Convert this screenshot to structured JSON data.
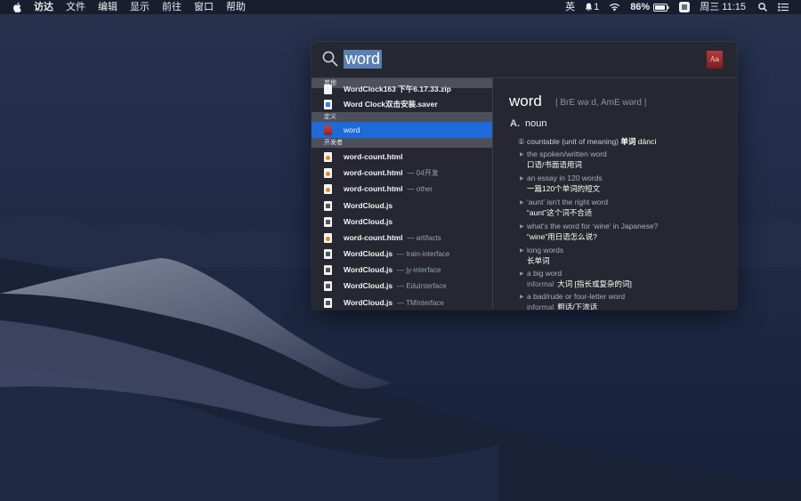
{
  "menubar": {
    "app_name": "访达",
    "items": [
      "文件",
      "编辑",
      "显示",
      "前往",
      "窗口",
      "帮助"
    ],
    "input_method": "英",
    "notification_count": "1",
    "battery": "86%",
    "clock": "周三 11:15"
  },
  "spotlight": {
    "query": "word",
    "sections": {
      "other": "其他",
      "definition": "定义",
      "developer": "开发者"
    },
    "results": [
      {
        "name": "WordClock163 下午6.17.33.zip",
        "sub": ""
      },
      {
        "name": "Word Clock双击安装.saver",
        "sub": ""
      },
      {
        "name": "word",
        "sub": ""
      },
      {
        "name": "word-count.html",
        "sub": ""
      },
      {
        "name": "word-count.html",
        "sub": "— 04开发"
      },
      {
        "name": "word-count.html",
        "sub": "— other"
      },
      {
        "name": "WordCloud.js",
        "sub": ""
      },
      {
        "name": "WordCloud.js",
        "sub": ""
      },
      {
        "name": "word-count.html",
        "sub": "— artifacts"
      },
      {
        "name": "WordCloud.js",
        "sub": "— train-interface"
      },
      {
        "name": "WordCloud.js",
        "sub": "— jy-interface"
      },
      {
        "name": "WordCloud.js",
        "sub": "— EduInterface"
      },
      {
        "name": "WordCloud.js",
        "sub": "— TMInterface"
      }
    ],
    "preview": {
      "word": "word",
      "pronunciation": "| BrE wəːd, AmE wərd |",
      "pos_letter": "A.",
      "pos": "noun",
      "sense_number": "①",
      "sense_label": "countable (unit of meaning)",
      "sense_cn": "单词",
      "sense_pinyin": "dāncí",
      "examples": [
        {
          "tag": "",
          "en": "the spoken/written word",
          "zh": "口语/书面语用词"
        },
        {
          "tag": "",
          "en": "an essay in 120 words",
          "zh": "一篇120个单词的短文"
        },
        {
          "tag": "",
          "en": "‘aunt’ isn't the right word",
          "zh": "“aunt”这个词不合适"
        },
        {
          "tag": "",
          "en": "what's the word for ‘wine’ in Japanese?",
          "zh": "“wine”用日语怎么说?"
        },
        {
          "tag": "",
          "en": "long words",
          "zh": "长单词"
        },
        {
          "tag": "informal",
          "en": "a big word",
          "zh": "大词 [指长或复杂的词]"
        },
        {
          "tag": "informal",
          "en": "a bad/rude or four-letter word",
          "zh": "粗话/下流话"
        }
      ]
    }
  }
}
